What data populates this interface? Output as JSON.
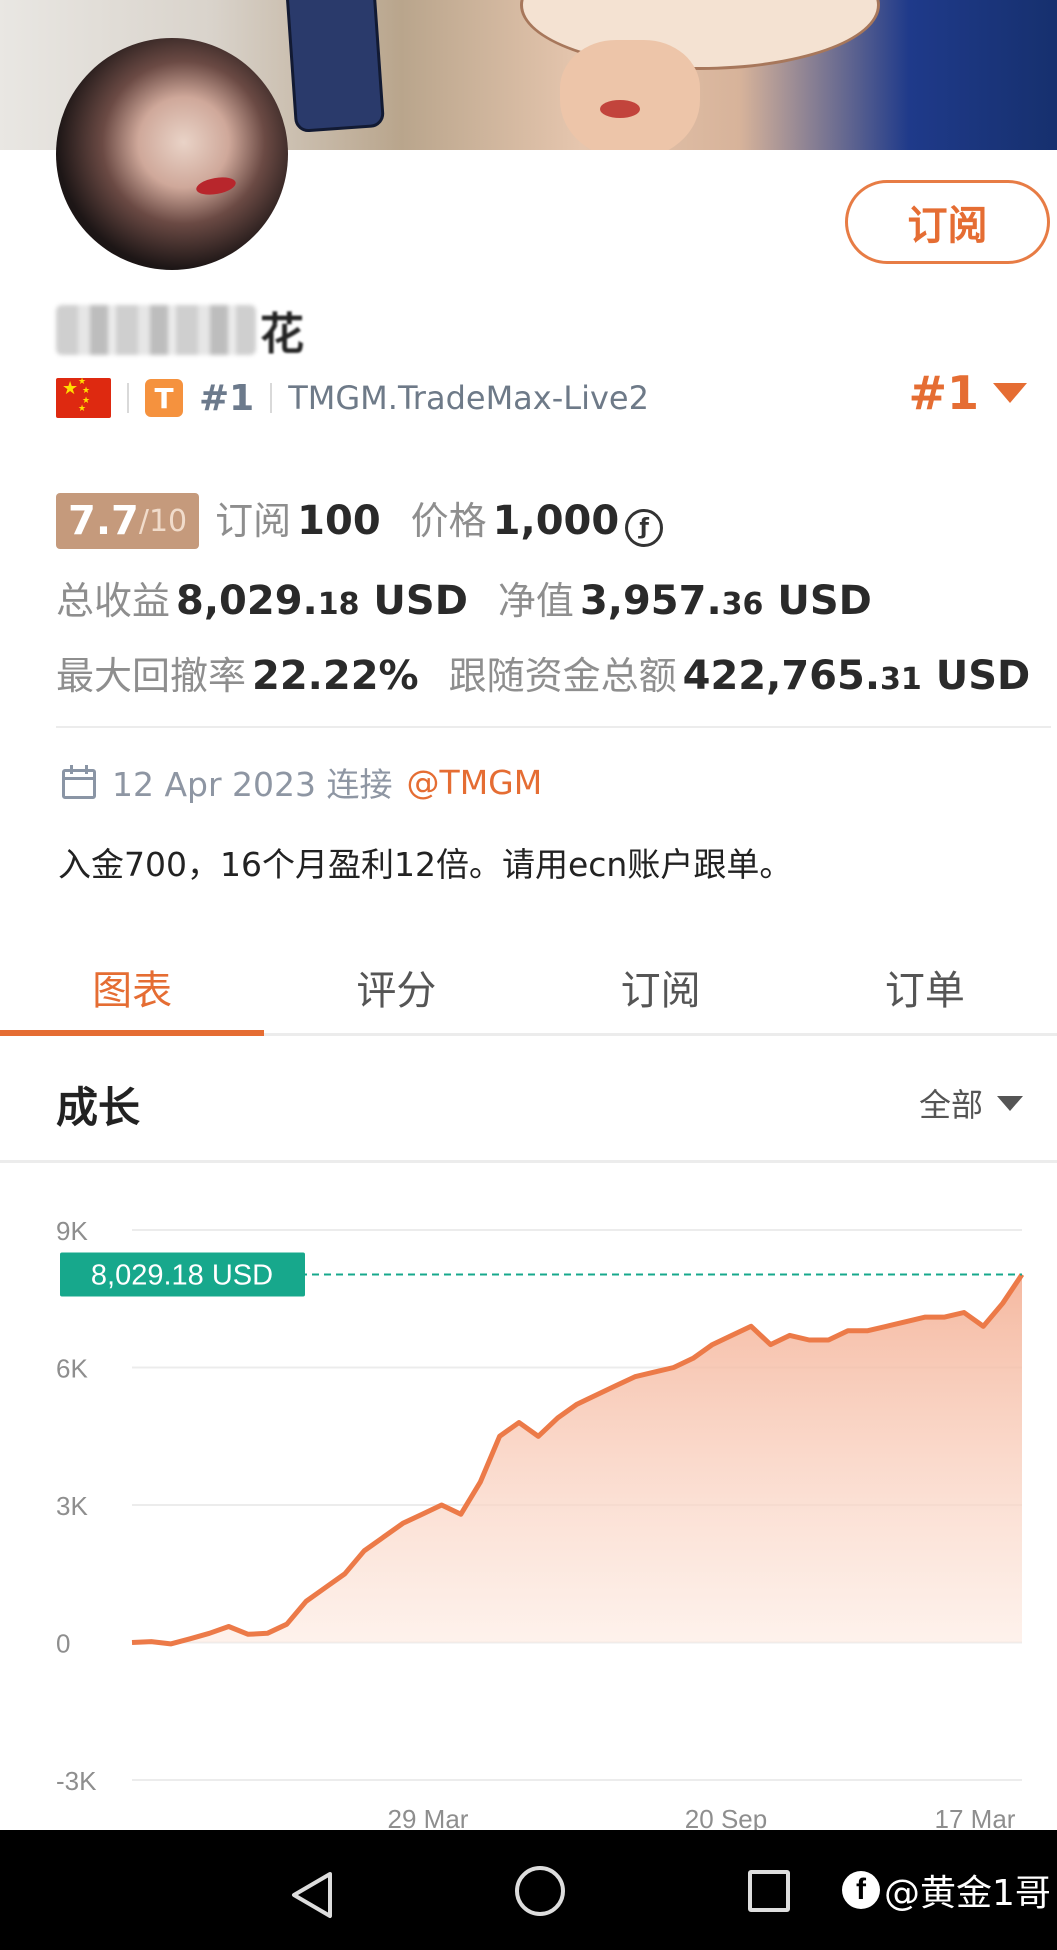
{
  "profile": {
    "name_visible_tail": "花",
    "subscribe_button": "订阅",
    "rank_small": "#1",
    "server": "TMGM.TradeMax-Live2",
    "rank_big": "#1",
    "broker_badge": "T"
  },
  "stats": {
    "rating_value": "7.7",
    "rating_of": "/10",
    "subscribers_label": "订阅",
    "subscribers_value": "100",
    "price_label": "价格",
    "price_value": "1,000",
    "price_coin_symbol": "ƒ",
    "total_profit_label": "总收益",
    "total_profit_main": "8,029.",
    "total_profit_dec": "18",
    "total_profit_unit": "USD",
    "equity_label": "净值",
    "equity_main": "3,957.",
    "equity_dec": "36",
    "equity_unit": "USD",
    "max_drawdown_label": "最大回撤率",
    "max_drawdown_value": "22.22%",
    "follow_funds_label": "跟随资金总额",
    "follow_funds_main": "422,765.",
    "follow_funds_dec": "31",
    "follow_funds_unit": "USD"
  },
  "connection": {
    "date": "12 Apr 2023 连接",
    "broker_link": "@TMGM"
  },
  "description": "入金700，16个月盈利12倍。请用ecn账户跟单。",
  "tabs": [
    {
      "label": "图表",
      "active": true
    },
    {
      "label": "评分",
      "active": false
    },
    {
      "label": "订阅",
      "active": false
    },
    {
      "label": "订单",
      "active": false
    }
  ],
  "section": {
    "title": "成长",
    "filter": "全部"
  },
  "chart_data": {
    "type": "area",
    "title": "成长",
    "y_ticks": [
      "9K",
      "6K",
      "3K",
      "0",
      "-3K"
    ],
    "ylim": [
      -3000,
      9000
    ],
    "x_tick_labels": [
      "29 Mar",
      "20 Sep",
      "17 Mar"
    ],
    "current_label": "8,029.18 USD",
    "current_value": 8029.18,
    "series": [
      {
        "values": [
          0,
          20,
          -30,
          80,
          200,
          350,
          180,
          200,
          400,
          900,
          1200,
          1500,
          2000,
          2300,
          2600,
          2800,
          3000,
          2800,
          3500,
          4500,
          4800,
          4500,
          4900,
          5200,
          5400,
          5600,
          5800,
          5900,
          6000,
          6200,
          6500,
          6700,
          6900,
          6500,
          6700,
          6600,
          6600,
          6800,
          6800,
          6900,
          7000,
          7100,
          7100,
          7200,
          6900,
          7400,
          8029.18
        ]
      }
    ],
    "colors": {
      "line": "#ec7a48",
      "fill": "#f6c2a8",
      "current_tag": "#17a88c"
    }
  },
  "watermark": "@黄金1哥"
}
